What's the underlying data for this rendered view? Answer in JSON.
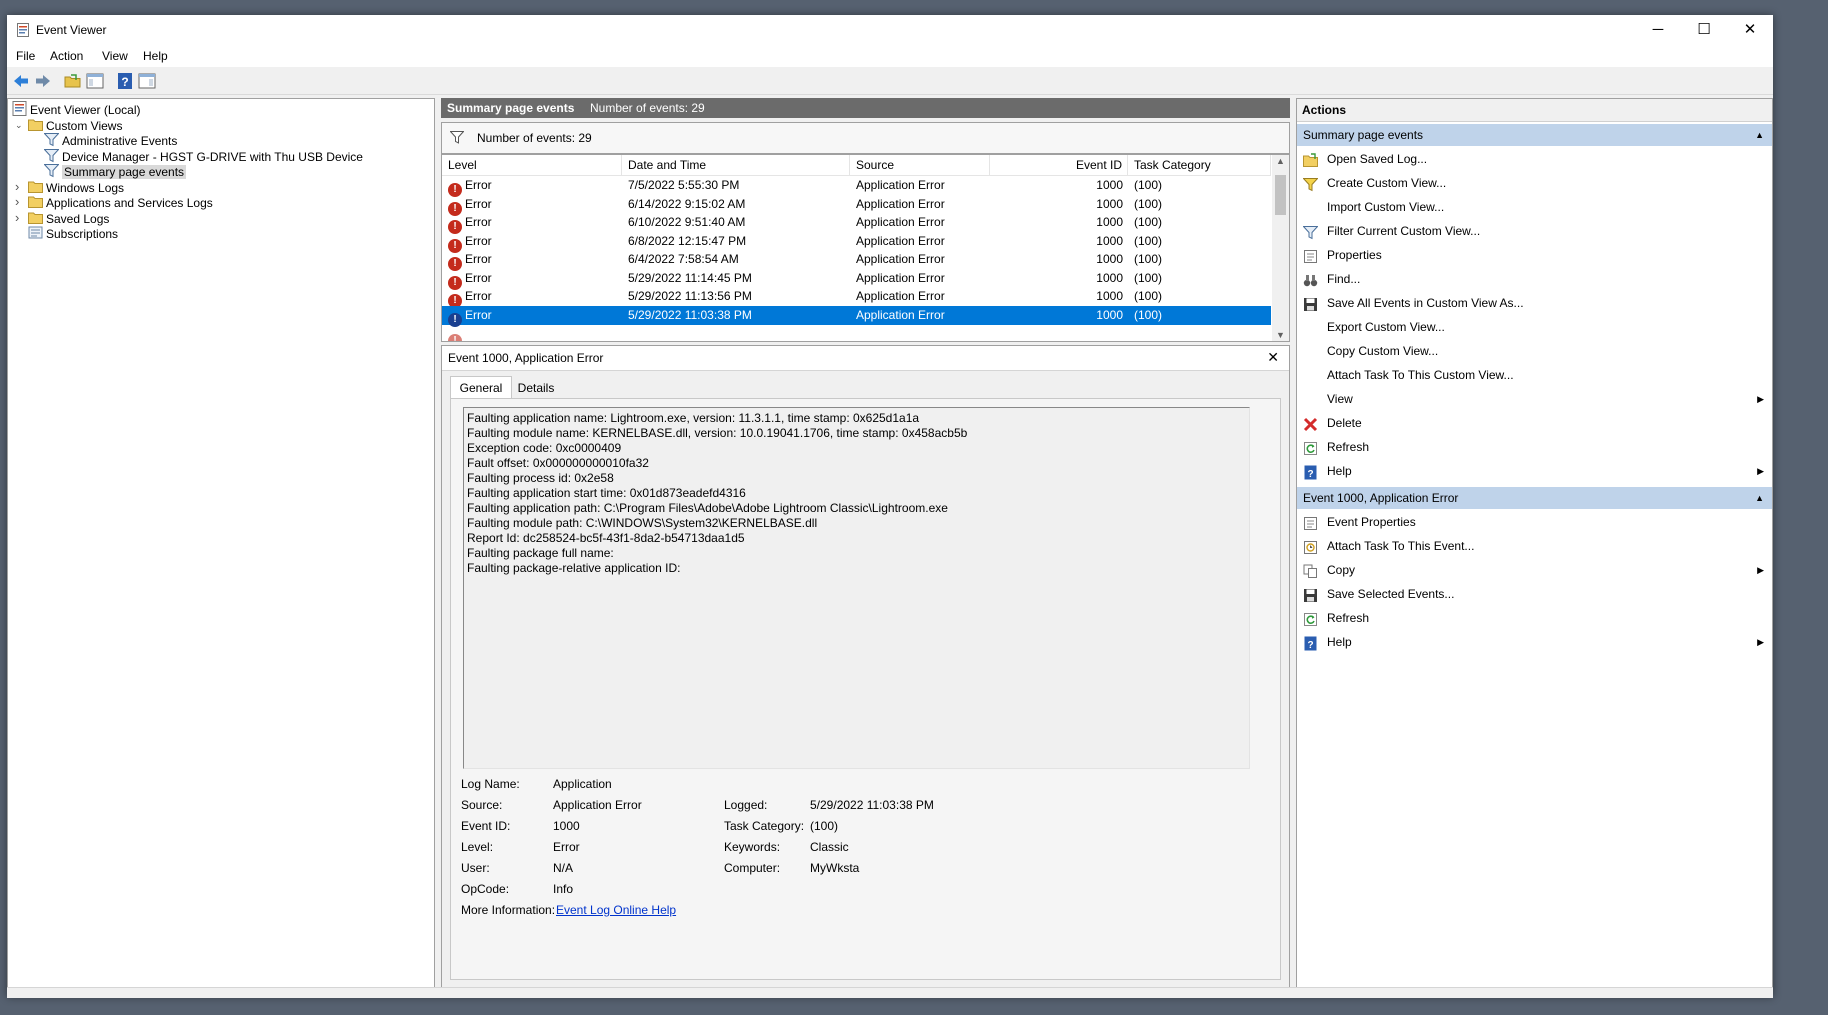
{
  "window": {
    "title": "Event Viewer",
    "controls": {
      "minimize": "─",
      "maximize": "☐",
      "close": "✕"
    }
  },
  "menu": [
    "File",
    "Action",
    "View",
    "Help"
  ],
  "tree": [
    {
      "label": "Event Viewer (Local)",
      "icon": "computer-icon",
      "indent": 0,
      "twisty": ""
    },
    {
      "label": "Custom Views",
      "icon": "folder-icon",
      "indent": 1,
      "twisty": "v"
    },
    {
      "label": "Administrative Events",
      "icon": "filter-icon",
      "indent": 2,
      "twisty": ""
    },
    {
      "label": "Device Manager - HGST G-DRIVE with Thu USB Device",
      "icon": "filter-icon",
      "indent": 2,
      "twisty": ""
    },
    {
      "label": "Summary page events",
      "icon": "filter-icon",
      "indent": 2,
      "twisty": "",
      "selected": true
    },
    {
      "label": "Windows Logs",
      "icon": "folder-icon",
      "indent": 1,
      "twisty": ">"
    },
    {
      "label": "Applications and Services Logs",
      "icon": "folder-icon",
      "indent": 1,
      "twisty": ">"
    },
    {
      "label": "Saved Logs",
      "icon": "folder-icon",
      "indent": 1,
      "twisty": ">"
    },
    {
      "label": "Subscriptions",
      "icon": "subscriptions-icon",
      "indent": 1,
      "twisty": ""
    }
  ],
  "events_panel": {
    "title": "Summary page events",
    "count_text": "Number of events: 29",
    "filter_text": "Number of events: 29",
    "columns": [
      "Level",
      "Date and Time",
      "Source",
      "Event ID",
      "Task Category"
    ],
    "rows": [
      {
        "level": "Error",
        "date": "7/5/2022 5:55:30 PM",
        "source": "Application Error",
        "id": "1000",
        "cat": "(100)"
      },
      {
        "level": "Error",
        "date": "6/14/2022 9:15:02 AM",
        "source": "Application Error",
        "id": "1000",
        "cat": "(100)"
      },
      {
        "level": "Error",
        "date": "6/10/2022 9:51:40 AM",
        "source": "Application Error",
        "id": "1000",
        "cat": "(100)"
      },
      {
        "level": "Error",
        "date": "6/8/2022 12:15:47 PM",
        "source": "Application Error",
        "id": "1000",
        "cat": "(100)"
      },
      {
        "level": "Error",
        "date": "6/4/2022 7:58:54 AM",
        "source": "Application Error",
        "id": "1000",
        "cat": "(100)"
      },
      {
        "level": "Error",
        "date": "5/29/2022 11:14:45 PM",
        "source": "Application Error",
        "id": "1000",
        "cat": "(100)"
      },
      {
        "level": "Error",
        "date": "5/29/2022 11:13:56 PM",
        "source": "Application Error",
        "id": "1000",
        "cat": "(100)"
      },
      {
        "level": "Error",
        "date": "5/29/2022 11:03:38 PM",
        "source": "Application Error",
        "id": "1000",
        "cat": "(100)",
        "selected": true
      }
    ]
  },
  "detail": {
    "title": "Event 1000, Application Error",
    "tabs": [
      "General",
      "Details"
    ],
    "description": [
      "Faulting application name: Lightroom.exe, version: 11.3.1.1, time stamp: 0x625d1a1a",
      "Faulting module name: KERNELBASE.dll, version: 10.0.19041.1706, time stamp: 0x458acb5b",
      "Exception code: 0xc0000409",
      "Fault offset: 0x000000000010fa32",
      "Faulting process id: 0x2e58",
      "Faulting application start time: 0x01d873eadefd4316",
      "Faulting application path: C:\\Program Files\\Adobe\\Adobe Lightroom Classic\\Lightroom.exe",
      "Faulting module path: C:\\WINDOWS\\System32\\KERNELBASE.dll",
      "Report Id: dc258524-bc5f-43f1-8da2-b54713daa1d5",
      "Faulting package full name:",
      "Faulting package-relative application ID:"
    ],
    "props_left": [
      {
        "label": "Log Name:",
        "value": "Application"
      },
      {
        "label": "Source:",
        "value": "Application Error"
      },
      {
        "label": "Event ID:",
        "value": "1000"
      },
      {
        "label": "Level:",
        "value": "Error"
      },
      {
        "label": "User:",
        "value": "N/A"
      },
      {
        "label": "OpCode:",
        "value": "Info"
      },
      {
        "label": "More Information:",
        "value": "Event Log Online Help"
      }
    ],
    "props_right": [
      {
        "label": "Logged:",
        "value": "5/29/2022 11:03:38 PM"
      },
      {
        "label": "Task Category:",
        "value": "(100)"
      },
      {
        "label": "Keywords:",
        "value": "Classic"
      },
      {
        "label": "Computer:",
        "value": "MyWksta"
      }
    ]
  },
  "actions": {
    "title": "Actions",
    "section1": {
      "title": "Summary page events",
      "items": [
        {
          "label": "Open Saved Log...",
          "icon": "open-folder-icon"
        },
        {
          "label": "Create Custom View...",
          "icon": "funnel-star-icon"
        },
        {
          "label": "Import Custom View...",
          "icon": ""
        },
        {
          "label": "Filter Current Custom View...",
          "icon": "filter-icon"
        },
        {
          "label": "Properties",
          "icon": "properties-icon"
        },
        {
          "label": "Find...",
          "icon": "binoculars-icon"
        },
        {
          "label": "Save All Events in Custom View As...",
          "icon": "save-icon"
        },
        {
          "label": "Export Custom View...",
          "icon": ""
        },
        {
          "label": "Copy Custom View...",
          "icon": ""
        },
        {
          "label": "Attach Task To This Custom View...",
          "icon": ""
        },
        {
          "label": "View",
          "icon": "",
          "submenu": true
        },
        {
          "label": "Delete",
          "icon": "delete-icon"
        },
        {
          "label": "Refresh",
          "icon": "refresh-icon"
        },
        {
          "label": "Help",
          "icon": "help-icon",
          "submenu": true
        }
      ]
    },
    "section2": {
      "title": "Event 1000, Application Error",
      "items": [
        {
          "label": "Event Properties",
          "icon": "properties-icon"
        },
        {
          "label": "Attach Task To This Event...",
          "icon": "task-icon"
        },
        {
          "label": "Copy",
          "icon": "copy-icon",
          "submenu": true
        },
        {
          "label": "Save Selected Events...",
          "icon": "save-icon"
        },
        {
          "label": "Refresh",
          "icon": "refresh-icon"
        },
        {
          "label": "Help",
          "icon": "help-icon",
          "submenu": true
        }
      ]
    }
  },
  "colors": {
    "selection": "#0078d7",
    "section_header": "#bfd3ea",
    "panel_header": "#6b6b6b",
    "error": "#c42b1c"
  }
}
